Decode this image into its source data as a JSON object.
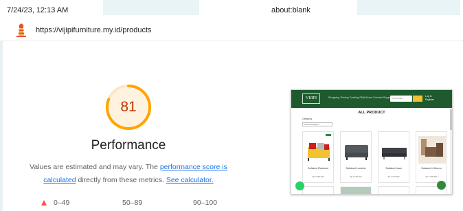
{
  "print_header": {
    "datetime": "7/24/23, 12:13 AM",
    "page_title": "about:blank"
  },
  "report": {
    "url": "https://vijipifurniture.my.id/products",
    "logo_icon": "lighthouse-icon"
  },
  "performance": {
    "score": "81",
    "score_fraction": 0.81,
    "score_color": "#ffa400",
    "score_text_color": "#c33300",
    "title": "Performance",
    "desc_prefix": "Values are estimated and may vary. The ",
    "desc_link1": "performance score is calculated",
    "desc_middle": " directly from these metrics. ",
    "desc_link2": "See calculator."
  },
  "legend": {
    "fail": "0–49",
    "average": "50–89",
    "pass": "90–100",
    "fail_color": "#ff4e42",
    "average_color": "#ffa400",
    "pass_color": "#0cce6b"
  },
  "screenshot": {
    "logo": "VIJIPI",
    "nav_menu": "Shopping   Pricing   Catalog   FAQ   About   Contact   Support",
    "search_placeholder": "Cari Produk",
    "auth": "Log in",
    "auth2": "Register",
    "heading": "ALL PRODUCT",
    "category_label": "Category",
    "category_value": "Semua Kategori",
    "brand_color": "#1e5a2e",
    "products": [
      {
        "name": "Sofabed Rainbow",
        "price": "Rp 2.650.000"
      },
      {
        "name": "Sofabed Lombok",
        "price": "Rp 1.679.000"
      },
      {
        "name": "Sofabed Java",
        "price": "Rp 1.374.000"
      },
      {
        "name": "Sofabed L Bromo",
        "price": "Rp 2.328.000"
      }
    ]
  }
}
